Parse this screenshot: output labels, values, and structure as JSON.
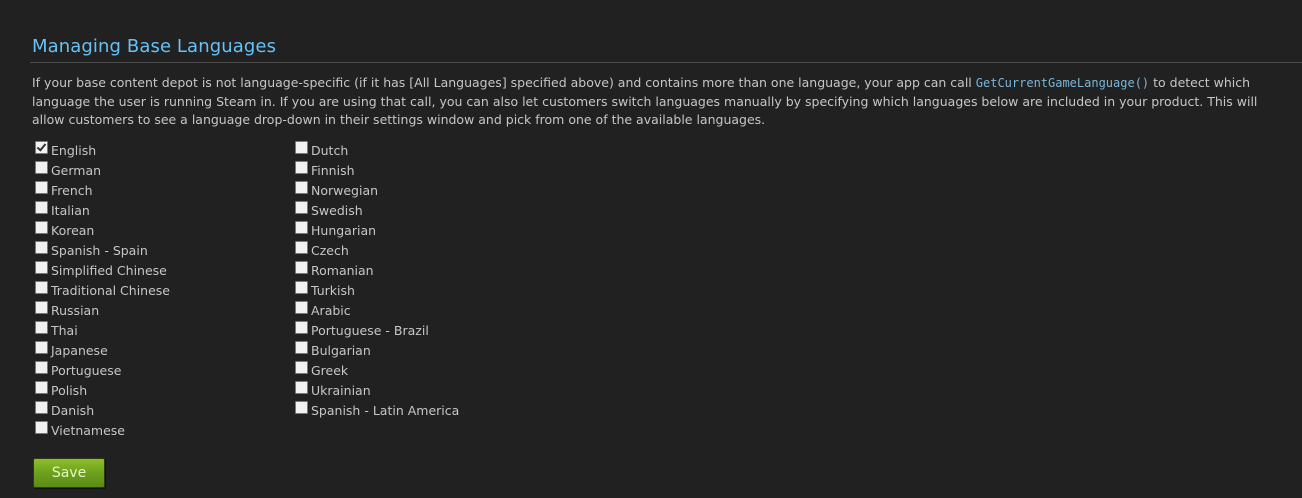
{
  "section": {
    "title": "Managing Base Languages",
    "description_before": "If your base content depot is not language-specific (if it has [All Languages] specified above) and contains more than one language, your app can call ",
    "code_call": "GetCurrentGameLanguage()",
    "description_after": " to detect which language the user is running Steam in. If you are using that call, you can also let customers switch languages manually by specifying which languages below are included in your product. This will allow customers to see a language drop-down in their settings window and pick from one of the available languages."
  },
  "languages": {
    "left": [
      {
        "label": "English",
        "checked": true
      },
      {
        "label": "German",
        "checked": false
      },
      {
        "label": "French",
        "checked": false
      },
      {
        "label": "Italian",
        "checked": false
      },
      {
        "label": "Korean",
        "checked": false
      },
      {
        "label": "Spanish - Spain",
        "checked": false
      },
      {
        "label": "Simplified Chinese",
        "checked": false
      },
      {
        "label": "Traditional Chinese",
        "checked": false
      },
      {
        "label": "Russian",
        "checked": false
      },
      {
        "label": "Thai",
        "checked": false
      },
      {
        "label": "Japanese",
        "checked": false
      },
      {
        "label": "Portuguese",
        "checked": false
      },
      {
        "label": "Polish",
        "checked": false
      },
      {
        "label": "Danish",
        "checked": false
      },
      {
        "label": "Vietnamese",
        "checked": false
      }
    ],
    "right": [
      {
        "label": "Dutch",
        "checked": false
      },
      {
        "label": "Finnish",
        "checked": false
      },
      {
        "label": "Norwegian",
        "checked": false
      },
      {
        "label": "Swedish",
        "checked": false
      },
      {
        "label": "Hungarian",
        "checked": false
      },
      {
        "label": "Czech",
        "checked": false
      },
      {
        "label": "Romanian",
        "checked": false
      },
      {
        "label": "Turkish",
        "checked": false
      },
      {
        "label": "Arabic",
        "checked": false
      },
      {
        "label": "Portuguese - Brazil",
        "checked": false
      },
      {
        "label": "Bulgarian",
        "checked": false
      },
      {
        "label": "Greek",
        "checked": false
      },
      {
        "label": "Ukrainian",
        "checked": false
      },
      {
        "label": "Spanish - Latin America",
        "checked": false
      }
    ]
  },
  "actions": {
    "save_label": "Save"
  },
  "colors": {
    "background": "#212121",
    "title": "#67c1f5",
    "code": "#7ab4d9",
    "body_text": "#c6c6c6",
    "save_button": "#6fa31e"
  }
}
